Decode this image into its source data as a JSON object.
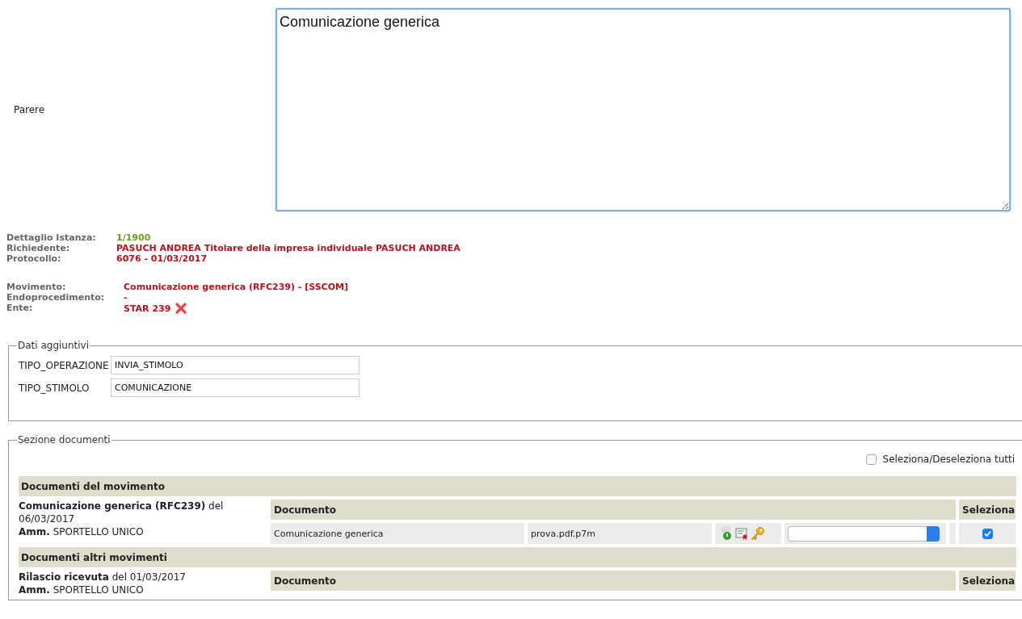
{
  "parere": {
    "label": "Parere",
    "value": "Comunicazione generica"
  },
  "istanza": [
    {
      "label": "Dettaglio Istanza:",
      "value": "1/1900",
      "color": "#6c9a1f"
    },
    {
      "label": "Richiedente:",
      "value": "PASUCH ANDREA Titolare della impresa individuale PASUCH ANDREA",
      "color": "#b2141b"
    },
    {
      "label": "Protocollo:",
      "value": "6076 - 01/03/2017",
      "color": "#b2141b"
    }
  ],
  "movimento": [
    {
      "label": "Movimento:",
      "value": "Comunicazione generica (RFC239) - [SSCOM]",
      "removable": false
    },
    {
      "label": "Endoprocedimento:",
      "value": "-",
      "removable": false
    },
    {
      "label": "Ente:",
      "value": "STAR 239",
      "removable": true
    }
  ],
  "dati_aggiuntivi": {
    "legend": "Dati aggiuntivi",
    "fields": [
      {
        "label": "TIPO_OPERAZIONE",
        "value": "INVIA_STIMOLO"
      },
      {
        "label": "TIPO_STIMOLO",
        "value": "COMUNICAZIONE"
      }
    ]
  },
  "sezione_documenti": {
    "legend": "Sezione documenti",
    "select_all": {
      "label": "Seleziona/Deseleziona tutti",
      "checked": false
    },
    "groups": [
      {
        "title": "Documenti del movimento",
        "entries": [
          {
            "movement": "**Comunicazione generica (RFC239)** del 06/03/2017",
            "office": "**Amm.** SPORTELLO UNICO",
            "columns": [
              "Documento",
              "Seleziona"
            ],
            "documents": [
              {
                "name": "Comunicazione generica",
                "file": "prova.pdf.p7m",
                "checked": true
              }
            ]
          }
        ]
      },
      {
        "title": "Documenti altri movimenti",
        "entries": [
          {
            "movement": "**Rilascio ricevuta** del 01/03/2017",
            "office": "**Amm.** SPORTELLO UNICO",
            "columns": [
              "Documento",
              "Seleziona"
            ]
          }
        ]
      }
    ]
  }
}
